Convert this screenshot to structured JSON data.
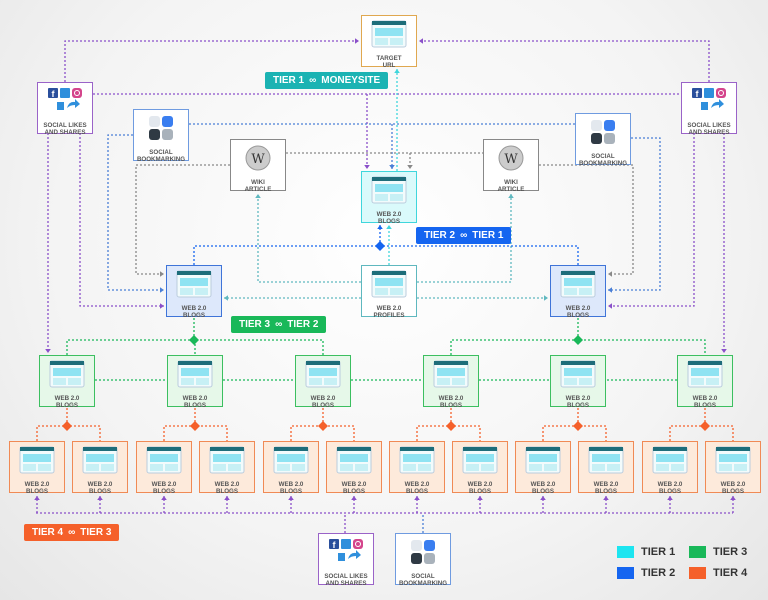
{
  "colors": {
    "tier1": "#1de5f0",
    "tier2": "#1565f0",
    "tier3": "#19b859",
    "tier4": "#f5602a",
    "social": "#8a4fc9",
    "bookmark": "#4a7fd6",
    "wiki": "#888888",
    "badge_tier1": "#1bb3b3"
  },
  "badges": {
    "tier1": {
      "left": "TIER 1",
      "right": "MONEYSITE",
      "icon": "link-icon"
    },
    "tier2": {
      "left": "TIER 2",
      "right": "TIER 1",
      "icon": "link-icon"
    },
    "tier3": {
      "left": "TIER 3",
      "right": "TIER 2",
      "icon": "link-icon"
    },
    "tier4": {
      "left": "TIER 4",
      "right": "TIER 3",
      "icon": "link-icon"
    }
  },
  "nodes": [
    {
      "id": "target",
      "label": [
        "TARGET",
        "URL"
      ],
      "icon": "webpage",
      "style": "target"
    },
    {
      "id": "social-left",
      "label": [
        "SOCIAL LIKES",
        "AND SHARES"
      ],
      "icon": "social",
      "style": "social"
    },
    {
      "id": "social-right",
      "label": [
        "SOCIAL LIKES",
        "AND SHARES"
      ],
      "icon": "social",
      "style": "social"
    },
    {
      "id": "bookmark-left",
      "label": [
        "SOCIAL",
        "BOOKMARKING"
      ],
      "icon": "bookmarking",
      "style": "bookmark"
    },
    {
      "id": "bookmark-right",
      "label": [
        "SOCIAL",
        "BOOKMARKING"
      ],
      "icon": "bookmarking",
      "style": "bookmark"
    },
    {
      "id": "wiki-left",
      "label": [
        "WIKI",
        "ARTICLE"
      ],
      "icon": "wikipedia",
      "style": "wiki"
    },
    {
      "id": "wiki-right",
      "label": [
        "WIKI",
        "ARTICLE"
      ],
      "icon": "wikipedia",
      "style": "wiki"
    },
    {
      "id": "t1-blog",
      "label": [
        "WEB 2.0",
        "BLOGS"
      ],
      "icon": "webpage",
      "style": "tier1"
    },
    {
      "id": "t2-blog-left",
      "label": [
        "WEB 2.0",
        "BLOGS"
      ],
      "icon": "webpage",
      "style": "tier2"
    },
    {
      "id": "t2-profiles",
      "label": [
        "WEB 2.0",
        "PROFILES"
      ],
      "icon": "webpage",
      "style": "profiles"
    },
    {
      "id": "t2-blog-right",
      "label": [
        "WEB 2.0",
        "BLOGS"
      ],
      "icon": "webpage",
      "style": "tier2"
    },
    {
      "id": "t3-1",
      "label": [
        "WEB 2.0",
        "BLOGS"
      ],
      "icon": "webpage",
      "style": "tier3"
    },
    {
      "id": "t3-2",
      "label": [
        "WEB 2.0",
        "BLOGS"
      ],
      "icon": "webpage",
      "style": "tier3"
    },
    {
      "id": "t3-3",
      "label": [
        "WEB 2.0",
        "BLOGS"
      ],
      "icon": "webpage",
      "style": "tier3"
    },
    {
      "id": "t3-4",
      "label": [
        "WEB 2.0",
        "BLOGS"
      ],
      "icon": "webpage",
      "style": "tier3"
    },
    {
      "id": "t3-5",
      "label": [
        "WEB 2.0",
        "BLOGS"
      ],
      "icon": "webpage",
      "style": "tier3"
    },
    {
      "id": "t3-6",
      "label": [
        "WEB 2.0",
        "BLOGS"
      ],
      "icon": "webpage",
      "style": "tier3"
    },
    {
      "id": "t4-1",
      "label": [
        "WEB 2.0",
        "BLOGS"
      ],
      "icon": "webpage",
      "style": "tier4"
    },
    {
      "id": "t4-2",
      "label": [
        "WEB 2.0",
        "BLOGS"
      ],
      "icon": "webpage",
      "style": "tier4"
    },
    {
      "id": "t4-3",
      "label": [
        "WEB 2.0",
        "BLOGS"
      ],
      "icon": "webpage",
      "style": "tier4"
    },
    {
      "id": "t4-4",
      "label": [
        "WEB 2.0",
        "BLOGS"
      ],
      "icon": "webpage",
      "style": "tier4"
    },
    {
      "id": "t4-5",
      "label": [
        "WEB 2.0",
        "BLOGS"
      ],
      "icon": "webpage",
      "style": "tier4"
    },
    {
      "id": "t4-6",
      "label": [
        "WEB 2.0",
        "BLOGS"
      ],
      "icon": "webpage",
      "style": "tier4"
    },
    {
      "id": "t4-7",
      "label": [
        "WEB 2.0",
        "BLOGS"
      ],
      "icon": "webpage",
      "style": "tier4"
    },
    {
      "id": "t4-8",
      "label": [
        "WEB 2.0",
        "BLOGS"
      ],
      "icon": "webpage",
      "style": "tier4"
    },
    {
      "id": "t4-9",
      "label": [
        "WEB 2.0",
        "BLOGS"
      ],
      "icon": "webpage",
      "style": "tier4"
    },
    {
      "id": "t4-10",
      "label": [
        "WEB 2.0",
        "BLOGS"
      ],
      "icon": "webpage",
      "style": "tier4"
    },
    {
      "id": "t4-11",
      "label": [
        "WEB 2.0",
        "BLOGS"
      ],
      "icon": "webpage",
      "style": "tier4"
    },
    {
      "id": "t4-12",
      "label": [
        "WEB 2.0",
        "BLOGS"
      ],
      "icon": "webpage",
      "style": "tier4"
    },
    {
      "id": "social-bottom",
      "label": [
        "SOCIAL LIKES",
        "AND SHARES"
      ],
      "icon": "social",
      "style": "social"
    },
    {
      "id": "bookmark-bottom",
      "label": [
        "SOCIAL",
        "BOOKMARKING"
      ],
      "icon": "bookmarking",
      "style": "bookmark"
    }
  ],
  "legend": [
    {
      "label": "TIER 1",
      "color": "#1de5f0"
    },
    {
      "label": "TIER 3",
      "color": "#19b859"
    },
    {
      "label": "TIER 2",
      "color": "#1565f0"
    },
    {
      "label": "TIER 4",
      "color": "#f5602a"
    }
  ]
}
